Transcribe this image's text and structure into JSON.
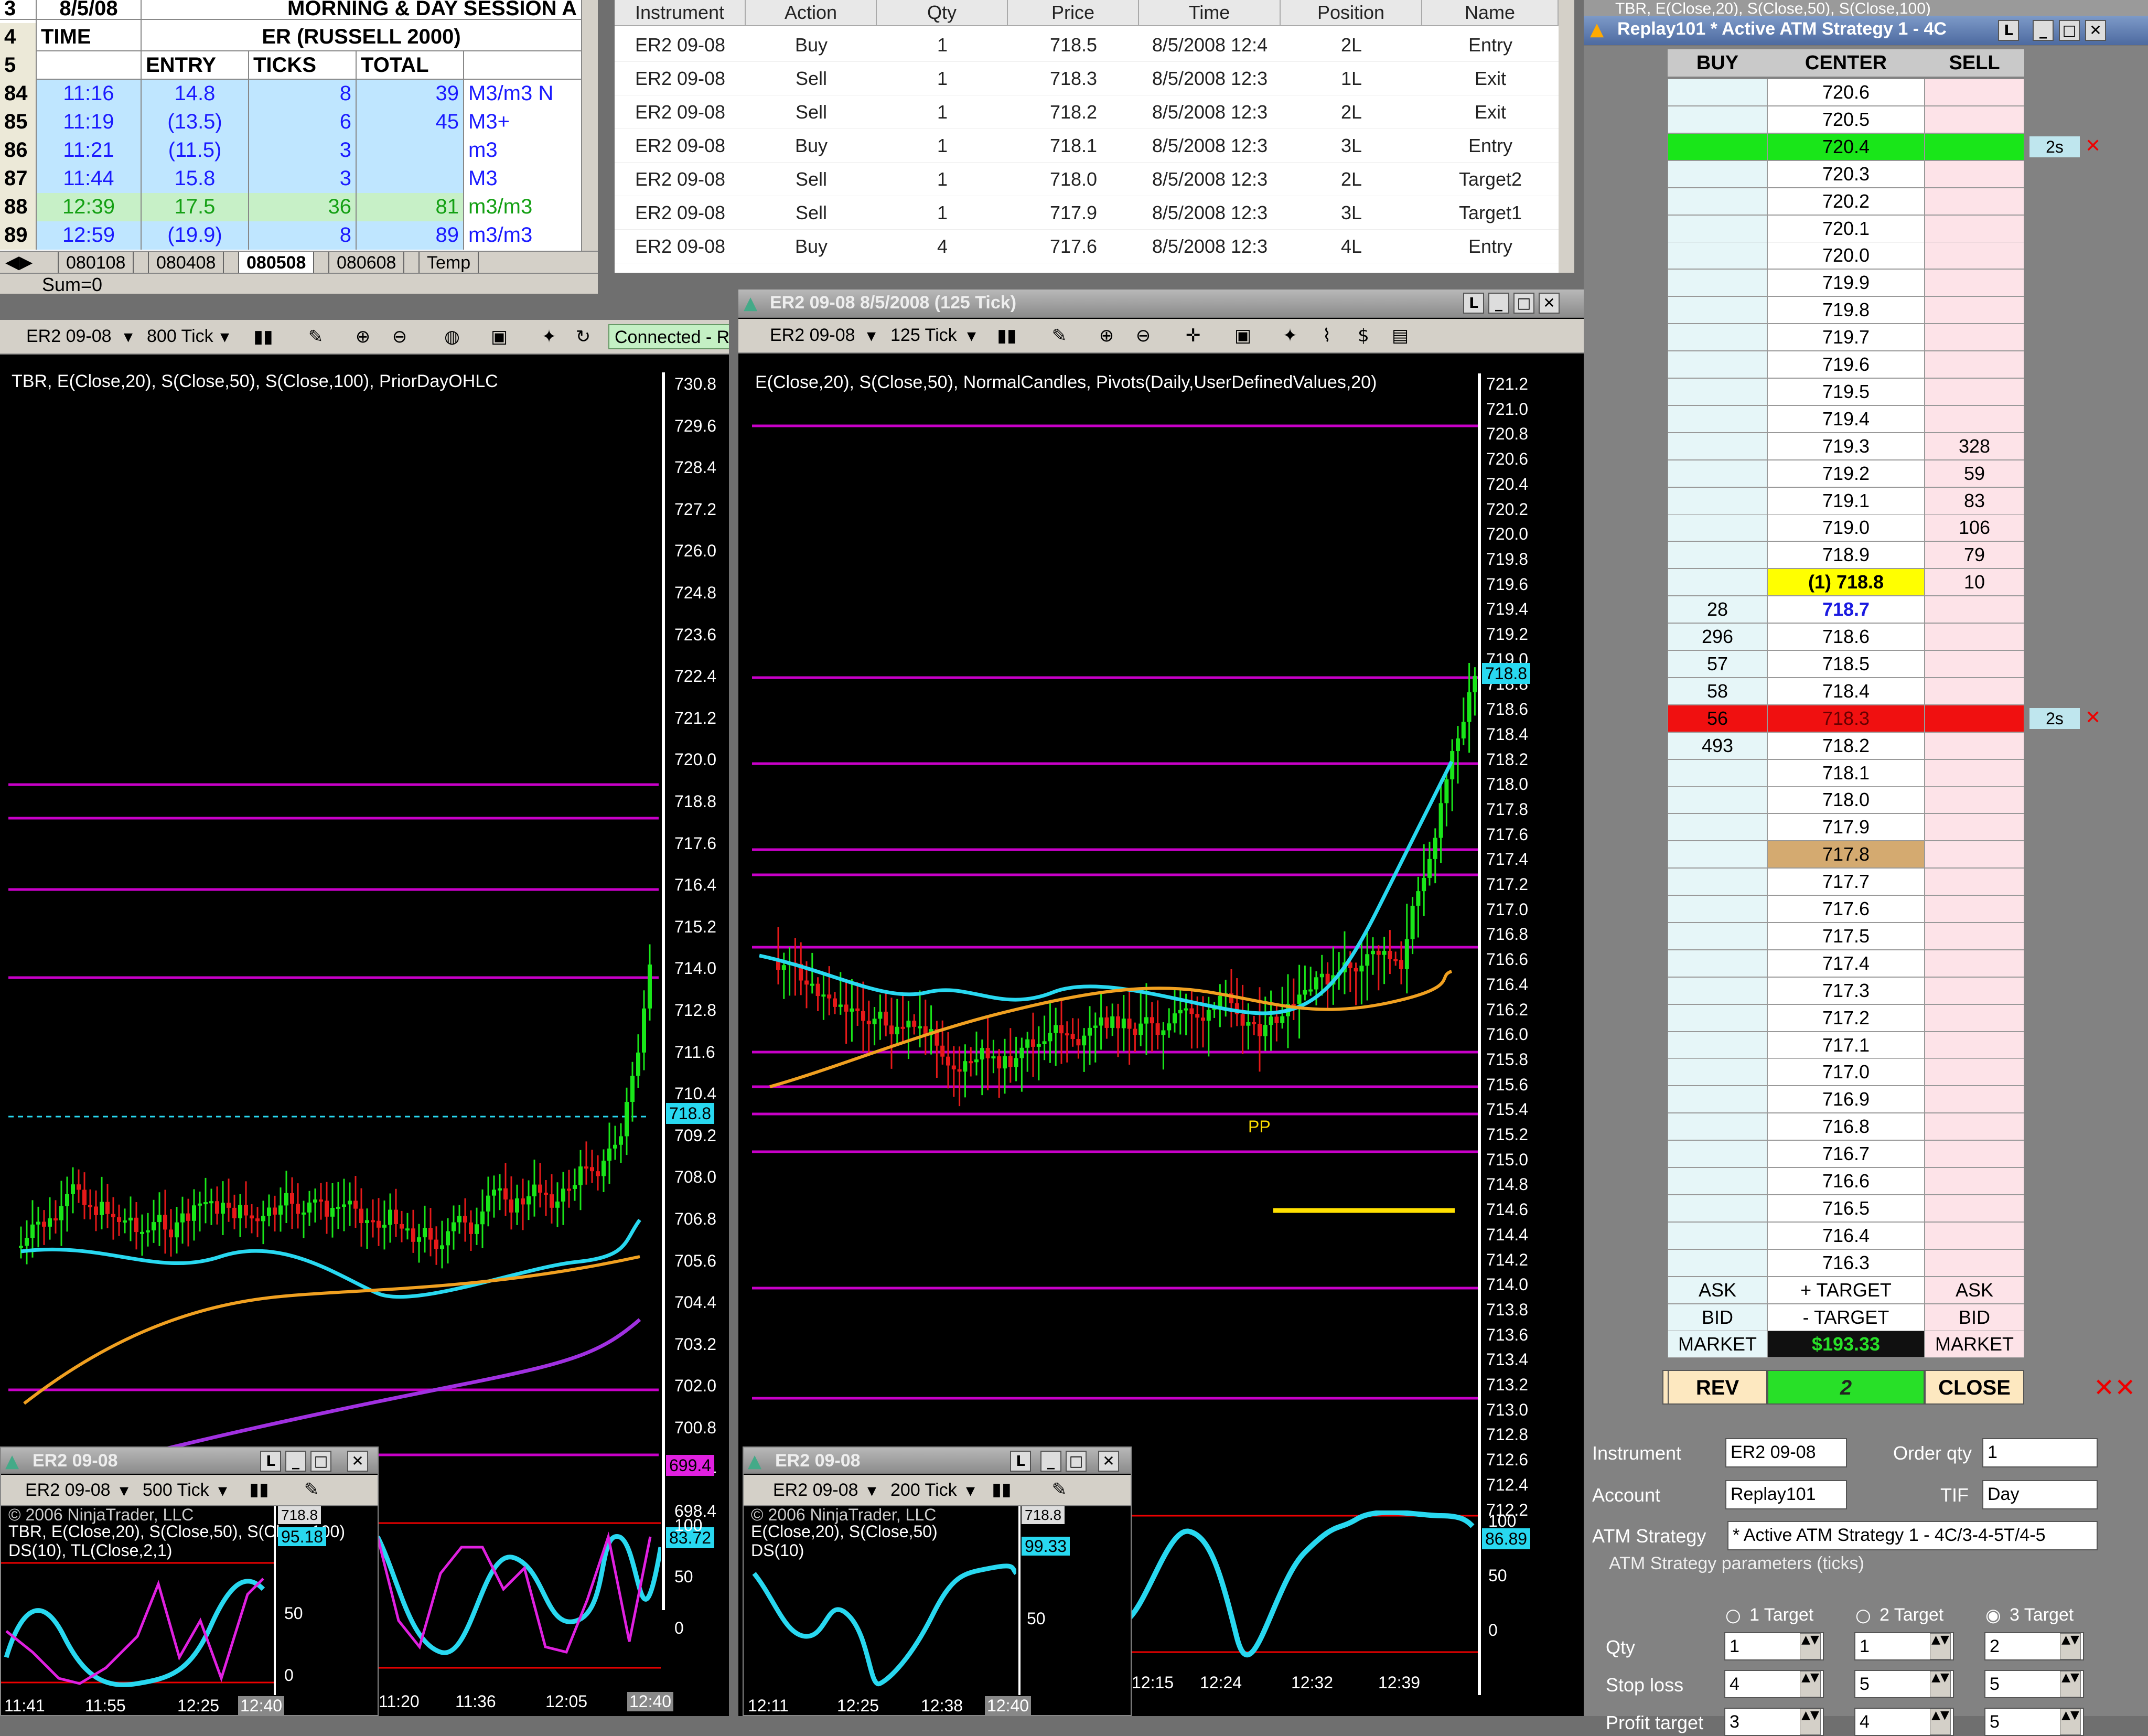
{
  "spreadsheet": {
    "title_row": {
      "num": "3",
      "date": "8/5/08",
      "session": "MORNING & DAY SESSION A"
    },
    "row4": {
      "num": "4",
      "time": "TIME",
      "er": "ER (RUSSELL 2000)"
    },
    "row5": {
      "num": "5",
      "entry": "ENTRY",
      "ticks": "TICKS",
      "total": "TOTAL"
    },
    "rows": [
      {
        "num": "84",
        "time": "11:16",
        "entry": "14.8",
        "ticks": "8",
        "total": "39",
        "note": "M3/m3 N",
        "color": "#1a1aff",
        "bg": "#bfe6ff"
      },
      {
        "num": "85",
        "time": "11:19",
        "entry": "(13.5)",
        "ticks": "6",
        "total": "45",
        "note": "M3+",
        "color": "#1a1aff",
        "bg": "#bfe6ff"
      },
      {
        "num": "86",
        "time": "11:21",
        "entry": "(11.5)",
        "ticks": "3",
        "total": "",
        "note": "m3",
        "color": "#1a1aff",
        "bg": "#bfe6ff"
      },
      {
        "num": "87",
        "time": "11:44",
        "entry": "15.8",
        "ticks": "3",
        "total": "",
        "note": "M3",
        "color": "#1a1aff",
        "bg": "#bfe6ff"
      },
      {
        "num": "88",
        "time": "12:39",
        "entry": "17.5",
        "ticks": "36",
        "total": "81",
        "note": "m3/m3",
        "color": "#14a014",
        "bg": "#c7f0c7"
      },
      {
        "num": "89",
        "time": "12:59",
        "entry": "(19.9)",
        "ticks": "8",
        "total": "89",
        "note": "m3/m3",
        "color": "#1a1aff",
        "bg": "#bfe6ff"
      }
    ],
    "sheet_tabs": [
      "080108",
      "080408",
      "080508",
      "080608",
      "Temp"
    ],
    "active_tab": "080508",
    "status": "Sum=0"
  },
  "orders": {
    "headers": [
      "Instrument",
      "Action",
      "Qty",
      "Price",
      "Time",
      "Position",
      "Name"
    ],
    "rows": [
      [
        "ER2 09-08",
        "Buy",
        "1",
        "718.5",
        "8/5/2008 12:4",
        "2L",
        "Entry"
      ],
      [
        "ER2 09-08",
        "Sell",
        "1",
        "718.3",
        "8/5/2008 12:3",
        "1L",
        "Exit"
      ],
      [
        "ER2 09-08",
        "Sell",
        "1",
        "718.2",
        "8/5/2008 12:3",
        "2L",
        "Exit"
      ],
      [
        "ER2 09-08",
        "Buy",
        "1",
        "718.1",
        "8/5/2008 12:3",
        "3L",
        "Entry"
      ],
      [
        "ER2 09-08",
        "Sell",
        "1",
        "718.0",
        "8/5/2008 12:3",
        "2L",
        "Target2"
      ],
      [
        "ER2 09-08",
        "Sell",
        "1",
        "717.9",
        "8/5/2008 12:3",
        "3L",
        "Target1"
      ],
      [
        "ER2 09-08",
        "Buy",
        "4",
        "717.6",
        "8/5/2008 12:3",
        "4L",
        "Entry"
      ]
    ]
  },
  "chart_left": {
    "instrument": "ER2 09-08",
    "interval": "800 Tick",
    "connection": "Connected - Re",
    "indicators": "TBR, E(Close,20), S(Close,50), S(Close,100), PriorDayOHLC",
    "y_ticks": [
      "730.8",
      "729.6",
      "728.4",
      "727.2",
      "726.0",
      "724.8",
      "723.6",
      "722.4",
      "721.2",
      "720.0",
      "718.8",
      "717.6",
      "716.4",
      "715.2",
      "714.0",
      "712.8",
      "711.6",
      "710.4",
      "709.2",
      "708.0",
      "706.8",
      "705.6",
      "704.4",
      "703.2",
      "702.0",
      "700.8",
      "699.4",
      "698.4"
    ],
    "price_tag": "718.8",
    "low_tag": "699.4",
    "osc_tag": "83.72",
    "osc_ticks": [
      "100",
      "50",
      "0"
    ],
    "x_ticks": [
      "11:20",
      "11:36",
      "12:05",
      "12:40"
    ]
  },
  "chart_mid": {
    "title": "ER2 09-08  8/5/2008 (125 Tick)",
    "instrument": "ER2 09-08",
    "interval": "125 Tick",
    "indicators": "E(Close,20), S(Close,50), NormalCandles, Pivots(Daily,UserDefinedValues,20)",
    "y_ticks": [
      "721.2",
      "721.0",
      "720.8",
      "720.6",
      "720.4",
      "720.2",
      "720.0",
      "719.8",
      "719.6",
      "719.4",
      "719.2",
      "719.0",
      "718.8",
      "718.6",
      "718.4",
      "718.2",
      "718.0",
      "717.8",
      "717.6",
      "717.4",
      "717.2",
      "717.0",
      "716.8",
      "716.6",
      "716.4",
      "716.2",
      "716.0",
      "715.8",
      "715.6",
      "715.4",
      "715.2",
      "715.0",
      "714.8",
      "714.6",
      "714.4",
      "714.2",
      "714.0",
      "713.8",
      "713.6",
      "713.4",
      "713.2",
      "713.0",
      "712.8",
      "712.6",
      "712.4",
      "712.2"
    ],
    "price_tag": "718.8",
    "pp_label": "PP",
    "osc_tag": "86.89",
    "osc_ticks": [
      "100",
      "50",
      "0"
    ],
    "x_ticks": [
      "12:15",
      "12:24",
      "12:32",
      "12:39"
    ]
  },
  "chart_small1": {
    "title": "ER2 09-08",
    "instrument": "ER2 09-08",
    "interval": "500 Tick",
    "copyright": "© 2006 NinjaTrader, LLC",
    "indicators": "TBR, E(Close,20), S(Close,50), S(Close,100)",
    "indicators2": "DS(10), TL(Close,2,1)",
    "osc_tag": "95.18",
    "price_tag": "718.8",
    "osc_ticks": [
      "50",
      "0"
    ],
    "x_ticks": [
      "11:41",
      "11:55",
      "12:25",
      "12:40"
    ]
  },
  "chart_small2": {
    "title": "ER2 09-08",
    "instrument": "ER2 09-08",
    "interval": "200 Tick",
    "copyright": "© 2006 NinjaTrader, LLC",
    "indicators": "E(Close,20), S(Close,50)",
    "indicators2": "DS(10)",
    "osc_tag": "99.33",
    "price_tag": "718.8",
    "osc_ticks": [
      "50"
    ],
    "x_ticks": [
      "12:11",
      "12:25",
      "12:38",
      "12:40"
    ]
  },
  "dom": {
    "title": "Replay101 * Active ATM Strategy 1 - 4C",
    "top_tab": "TBR, E(Close,20), S(Close,50), S(Close,100)",
    "headers": [
      "BUY",
      "CENTER",
      "SELL"
    ],
    "rows": [
      {
        "buy": "",
        "price": "720.6",
        "sell": ""
      },
      {
        "buy": "",
        "price": "720.5",
        "sell": ""
      },
      {
        "buy": "",
        "price": "720.4",
        "sell": "",
        "hl": "green",
        "tag": "2s"
      },
      {
        "buy": "",
        "price": "720.3",
        "sell": ""
      },
      {
        "buy": "",
        "price": "720.2",
        "sell": ""
      },
      {
        "buy": "",
        "price": "720.1",
        "sell": ""
      },
      {
        "buy": "",
        "price": "720.0",
        "sell": ""
      },
      {
        "buy": "",
        "price": "719.9",
        "sell": ""
      },
      {
        "buy": "",
        "price": "719.8",
        "sell": ""
      },
      {
        "buy": "",
        "price": "719.7",
        "sell": ""
      },
      {
        "buy": "",
        "price": "719.6",
        "sell": ""
      },
      {
        "buy": "",
        "price": "719.5",
        "sell": ""
      },
      {
        "buy": "",
        "price": "719.4",
        "sell": ""
      },
      {
        "buy": "",
        "price": "719.3",
        "sell": "328"
      },
      {
        "buy": "",
        "price": "719.2",
        "sell": "59"
      },
      {
        "buy": "",
        "price": "719.1",
        "sell": "83"
      },
      {
        "buy": "",
        "price": "719.0",
        "sell": "106"
      },
      {
        "buy": "",
        "price": "718.9",
        "sell": "79"
      },
      {
        "buy": "",
        "price": "(1) 718.8",
        "sell": "10",
        "hl": "yellow"
      },
      {
        "buy": "28",
        "price": "718.7",
        "sell": "",
        "hl": "bold"
      },
      {
        "buy": "296",
        "price": "718.6",
        "sell": ""
      },
      {
        "buy": "57",
        "price": "718.5",
        "sell": ""
      },
      {
        "buy": "58",
        "price": "718.4",
        "sell": ""
      },
      {
        "buy": "56",
        "price": "718.3",
        "sell": "",
        "hl": "red",
        "tag": "2s"
      },
      {
        "buy": "493",
        "price": "718.2",
        "sell": ""
      },
      {
        "buy": "",
        "price": "718.1",
        "sell": ""
      },
      {
        "buy": "",
        "price": "718.0",
        "sell": ""
      },
      {
        "buy": "",
        "price": "717.9",
        "sell": ""
      },
      {
        "buy": "",
        "price": "717.8",
        "sell": "",
        "hl": "tan"
      },
      {
        "buy": "",
        "price": "717.7",
        "sell": ""
      },
      {
        "buy": "",
        "price": "717.6",
        "sell": ""
      },
      {
        "buy": "",
        "price": "717.5",
        "sell": ""
      },
      {
        "buy": "",
        "price": "717.4",
        "sell": ""
      },
      {
        "buy": "",
        "price": "717.3",
        "sell": ""
      },
      {
        "buy": "",
        "price": "717.2",
        "sell": ""
      },
      {
        "buy": "",
        "price": "717.1",
        "sell": ""
      },
      {
        "buy": "",
        "price": "717.0",
        "sell": ""
      },
      {
        "buy": "",
        "price": "716.9",
        "sell": ""
      },
      {
        "buy": "",
        "price": "716.8",
        "sell": ""
      },
      {
        "buy": "",
        "price": "716.7",
        "sell": ""
      },
      {
        "buy": "",
        "price": "716.6",
        "sell": ""
      },
      {
        "buy": "",
        "price": "716.5",
        "sell": ""
      },
      {
        "buy": "",
        "price": "716.4",
        "sell": ""
      },
      {
        "buy": "",
        "price": "716.3",
        "sell": ""
      }
    ],
    "footer": [
      [
        "ASK",
        "+ TARGET",
        "ASK"
      ],
      [
        "BID",
        "- TARGET",
        "BID"
      ],
      [
        "MARKET",
        "$193.33",
        "MARKET"
      ]
    ],
    "rev": "REV",
    "position": "2",
    "close": "CLOSE",
    "left_arrow": "<",
    "form": {
      "instrument_label": "Instrument",
      "instrument": "ER2 09-08",
      "order_qty_label": "Order qty",
      "order_qty": "1",
      "account_label": "Account",
      "account": "Replay101",
      "tif_label": "TIF",
      "tif": "Day",
      "atm_label": "ATM Strategy",
      "atm": "* Active ATM Strategy 1 - 4C/3-4-5T/4-5",
      "params_label": "ATM Strategy parameters (ticks)",
      "target_options": [
        "1 Target",
        "2 Target",
        "3 Target"
      ],
      "selected_target": "3 Target",
      "qty_label": "Qty",
      "qty": [
        "1",
        "1",
        "2"
      ],
      "stop_label": "Stop loss",
      "stop": [
        "4",
        "5",
        "5"
      ],
      "profit_label": "Profit target",
      "profit": [
        "3",
        "4",
        "5"
      ]
    }
  }
}
